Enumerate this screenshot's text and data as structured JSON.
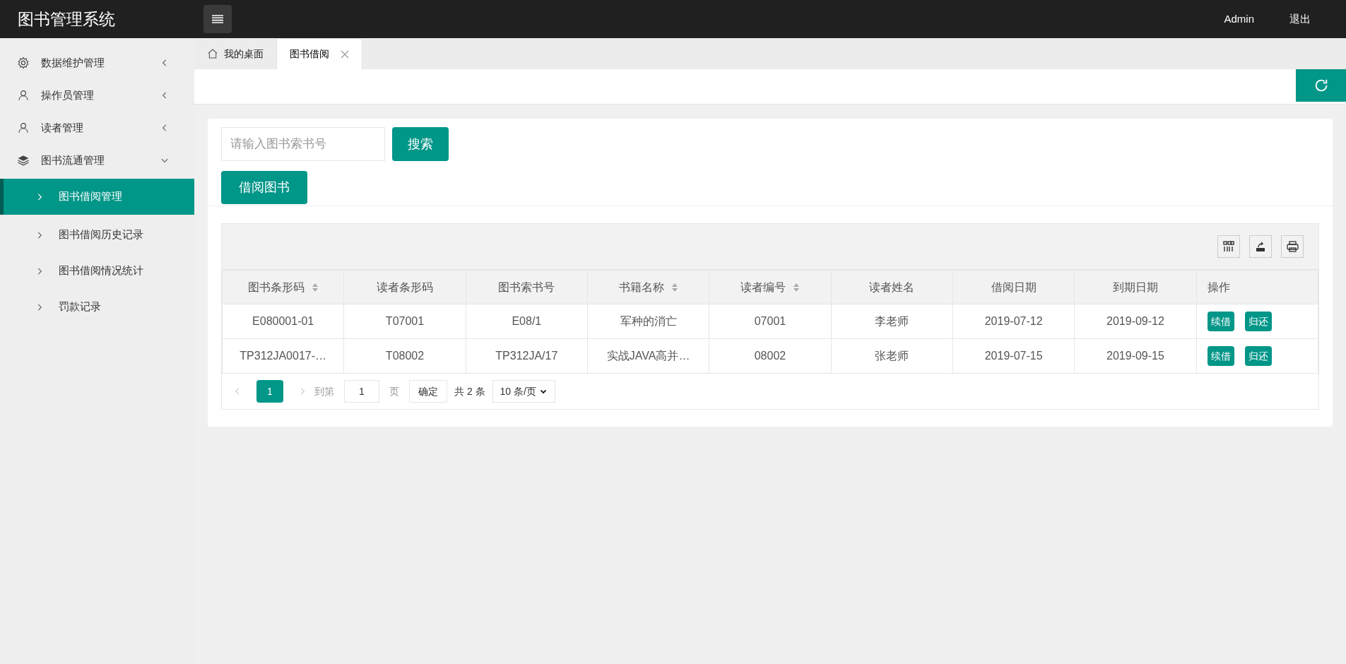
{
  "header": {
    "title": "图书管理系统",
    "user": "Admin",
    "logout": "退出"
  },
  "sidebar": {
    "items": [
      {
        "label": "数据维护管理",
        "expanded": false
      },
      {
        "label": "操作员管理",
        "expanded": false
      },
      {
        "label": "读者管理",
        "expanded": false
      },
      {
        "label": "图书流通管理",
        "expanded": true,
        "children": [
          {
            "label": "图书借阅管理",
            "selected": true
          },
          {
            "label": "图书借阅历史记录",
            "selected": false
          },
          {
            "label": "图书借阅情况统计",
            "selected": false
          },
          {
            "label": "罚款记录",
            "selected": false
          }
        ]
      }
    ]
  },
  "tabs": [
    {
      "label": "我的桌面",
      "closable": false,
      "selected": false
    },
    {
      "label": "图书借阅",
      "closable": true,
      "selected": true
    }
  ],
  "search": {
    "placeholder": "请输入图书索书号",
    "button": "搜索"
  },
  "borrow_button": "借阅图书",
  "table": {
    "columns": [
      {
        "label": "图书条形码",
        "sortable": true
      },
      {
        "label": "读者条形码",
        "sortable": false
      },
      {
        "label": "图书索书号",
        "sortable": false
      },
      {
        "label": "书籍名称",
        "sortable": true
      },
      {
        "label": "读者编号",
        "sortable": true
      },
      {
        "label": "读者姓名",
        "sortable": false
      },
      {
        "label": "借阅日期",
        "sortable": false
      },
      {
        "label": "到期日期",
        "sortable": false
      },
      {
        "label": "操作",
        "sortable": false
      }
    ],
    "rows": [
      {
        "cells": [
          "E080001-01",
          "T07001",
          "E08/1",
          "军种的消亡",
          "07001",
          "李老师",
          "2019-07-12",
          "2019-09-12"
        ],
        "actions": [
          "续借",
          "归还"
        ]
      },
      {
        "cells": [
          "TP312JA0017-…",
          "T08002",
          "TP312JA/17",
          "实战JAVA高并…",
          "08002",
          "张老师",
          "2019-07-15",
          "2019-09-15"
        ],
        "actions": [
          "续借",
          "归还"
        ]
      }
    ]
  },
  "pagination": {
    "pages": [
      {
        "label": "1",
        "selected": true
      }
    ],
    "goto_label": "到第",
    "page_value": "1",
    "page_unit": "页",
    "confirm": "确定",
    "total": "共 2 条",
    "page_size": "10 条/页"
  }
}
